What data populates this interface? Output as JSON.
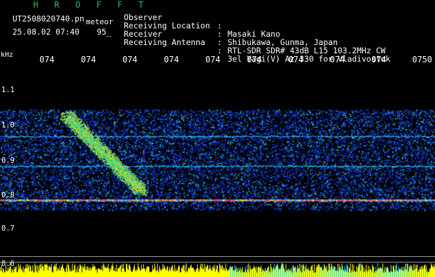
{
  "header": {
    "brand": "H R O F F T",
    "filename": "UT2508020740.pn",
    "tag": "meteor",
    "datetime": "25.08.02 07:40",
    "percent": "95_"
  },
  "meta": [
    {
      "key": "Observer",
      "value": "Masaki Kano"
    },
    {
      "key": "Receiving Location",
      "value": "Shibukawa, Gunma, Japan"
    },
    {
      "key": "Receiver",
      "value": "RTL-SDR SDR# 43dB L15 103.2MHz CW"
    },
    {
      "key": "Receiving Antenna",
      "value": "3el Yagi(V) Az 330 for Vladivostok"
    }
  ],
  "axis": {
    "unit": "kHz",
    "x_ticks": [
      "074",
      "074",
      "074",
      "074",
      "074",
      "074",
      "074",
      "074",
      "074",
      "0750"
    ],
    "y_ticks": [
      "1.1",
      "1.0",
      "0.9",
      "0.8",
      "0.7",
      "0.6"
    ]
  },
  "colors": {
    "background": "#000000",
    "brand": "#22c55e",
    "noise": "#1d4ed8",
    "signal_hot": "#f43f5e",
    "signal_warm": "#facc15",
    "echo": "#34d399",
    "bottom_bar": "#ffff00",
    "bottom_bar_alt": "#22d3ee"
  }
}
